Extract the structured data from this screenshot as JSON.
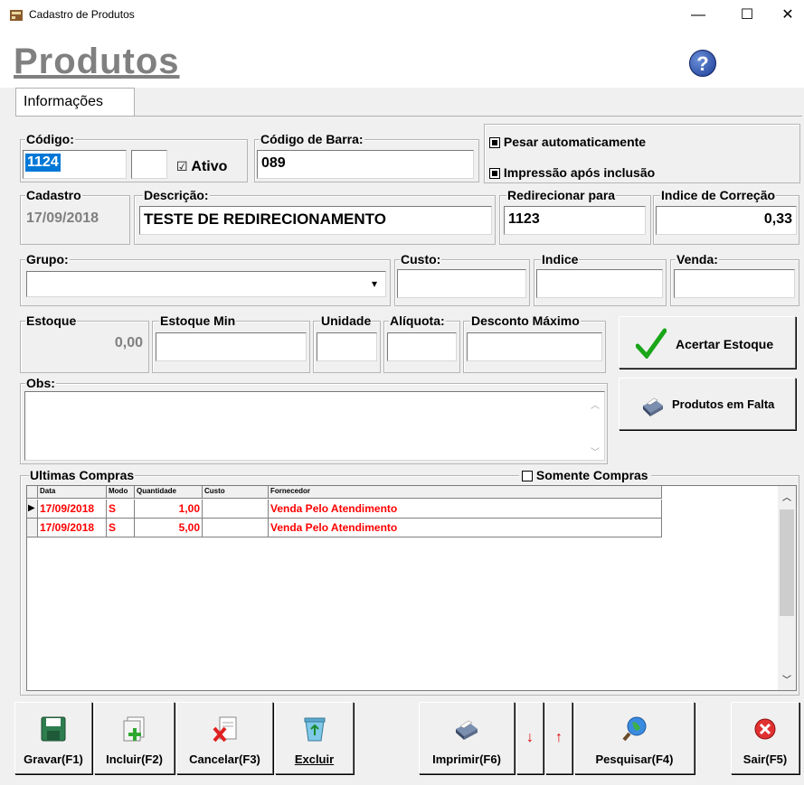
{
  "window": {
    "title": "Cadastro de Produtos",
    "minimize": "—",
    "maximize": "☐",
    "close": "✕"
  },
  "header": {
    "title": "Produtos",
    "help": "?"
  },
  "tabs": [
    {
      "label": "Informações"
    }
  ],
  "fields": {
    "codigo": {
      "label": "Código:",
      "value": "1124",
      "extra": ""
    },
    "ativo": {
      "label": "Ativo",
      "checked": true,
      "mark": "☑"
    },
    "codigo_barra": {
      "label": "Código de Barra:",
      "value": "089"
    },
    "pesar": {
      "label": "Pesar automaticamente",
      "checked": true
    },
    "impressao": {
      "label": "Impressão após inclusão",
      "checked": true
    },
    "cadastro": {
      "label": "Cadastro",
      "value": "17/09/2018"
    },
    "descricao": {
      "label": "Descrição:",
      "value": "TESTE DE REDIRECIONAMENTO"
    },
    "redirecionar": {
      "label": "Redirecionar para",
      "value": "1123"
    },
    "indice_correcao": {
      "label": "Indice de Correção",
      "value": "0,33"
    },
    "grupo": {
      "label": "Grupo:",
      "value": "",
      "arrow": "▾"
    },
    "custo": {
      "label": "Custo:",
      "value": ""
    },
    "indice": {
      "label": "Indice",
      "value": ""
    },
    "venda": {
      "label": "Venda:",
      "value": ""
    },
    "estoque": {
      "label": "Estoque",
      "value": "0,00"
    },
    "estoque_min": {
      "label": "Estoque Min",
      "value": ""
    },
    "unidade": {
      "label": "Unidade",
      "value": ""
    },
    "aliquota": {
      "label": "Alíquota:",
      "value": ""
    },
    "desconto": {
      "label": "Desconto Máximo",
      "value": ""
    },
    "obs": {
      "label": "Obs:",
      "value": ""
    }
  },
  "side_buttons": {
    "acertar": "Acertar Estoque",
    "faltas": "Produtos em Falta"
  },
  "compras": {
    "label": "Ultimas Compras",
    "somente_label": "Somente Compras",
    "somente_checked": false,
    "columns": [
      "Data",
      "Modo",
      "Quantidade",
      "Custo",
      "Fornecedor"
    ],
    "rows": [
      {
        "data": "17/09/2018",
        "modo": "S",
        "quantidade": "1,00",
        "custo": "",
        "fornecedor": "Venda Pelo Atendimento",
        "current": true
      },
      {
        "data": "17/09/2018",
        "modo": "S",
        "quantidade": "5,00",
        "custo": "",
        "fornecedor": "Venda Pelo Atendimento",
        "current": false
      }
    ],
    "row_marker": "▶"
  },
  "toolbar": {
    "gravar": "Gravar(F1)",
    "incluir": "Incluir(F2)",
    "cancelar": "Cancelar(F3)",
    "excluir": "Excluir",
    "imprimir": "Imprimir(F6)",
    "down": "↓",
    "up": "↑",
    "pesquisar": "Pesquisar(F4)",
    "sair": "Sair(F5)"
  },
  "colors": {
    "red": "#ff0000",
    "gray_title": "#808080",
    "help_blue": "#1d3c96"
  }
}
